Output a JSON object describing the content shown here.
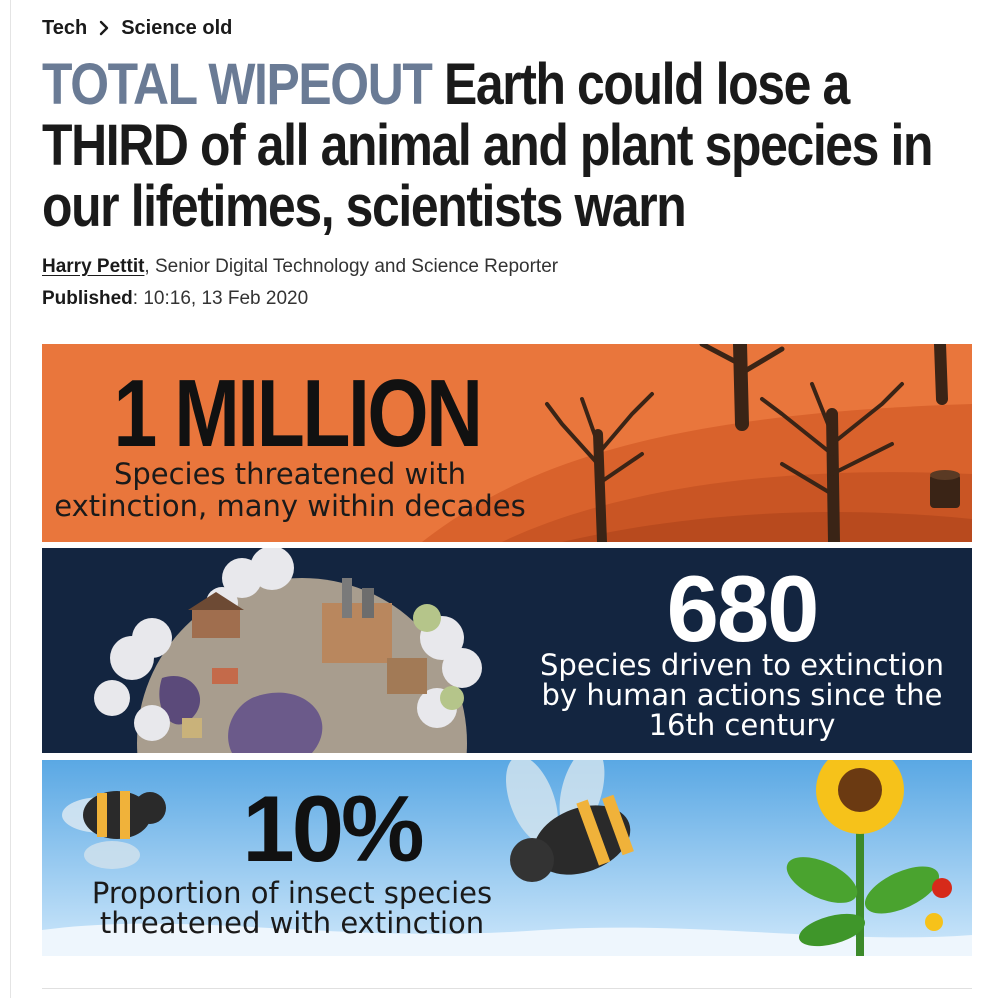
{
  "breadcrumb": {
    "items": [
      "Tech",
      "Science old"
    ]
  },
  "headline": {
    "kicker": "TOTAL WIPEOUT",
    "title": "Earth could lose a THIRD of all animal and plant species in our lifetimes, scientists warn"
  },
  "byline": {
    "author": "Harry Pettit",
    "role": ", Senior Digital Technology and Science Reporter"
  },
  "published": {
    "label": "Published",
    "value": ": 10:16, 13 Feb 2020"
  },
  "infographic": {
    "panels": [
      {
        "big": "1 MILLION",
        "sub": "Species threatened with extinction, many within decades"
      },
      {
        "big": "680",
        "sub": "Species driven to extinction by human actions since the 16th century"
      },
      {
        "big": "10%",
        "sub": "Proportion of insect species threatened with extinction"
      }
    ]
  },
  "colors": {
    "kicker": "#6a7b95",
    "panel_orange": "#e9763c",
    "panel_navy": "#132540",
    "panel_sky": "#7ec0ee"
  }
}
